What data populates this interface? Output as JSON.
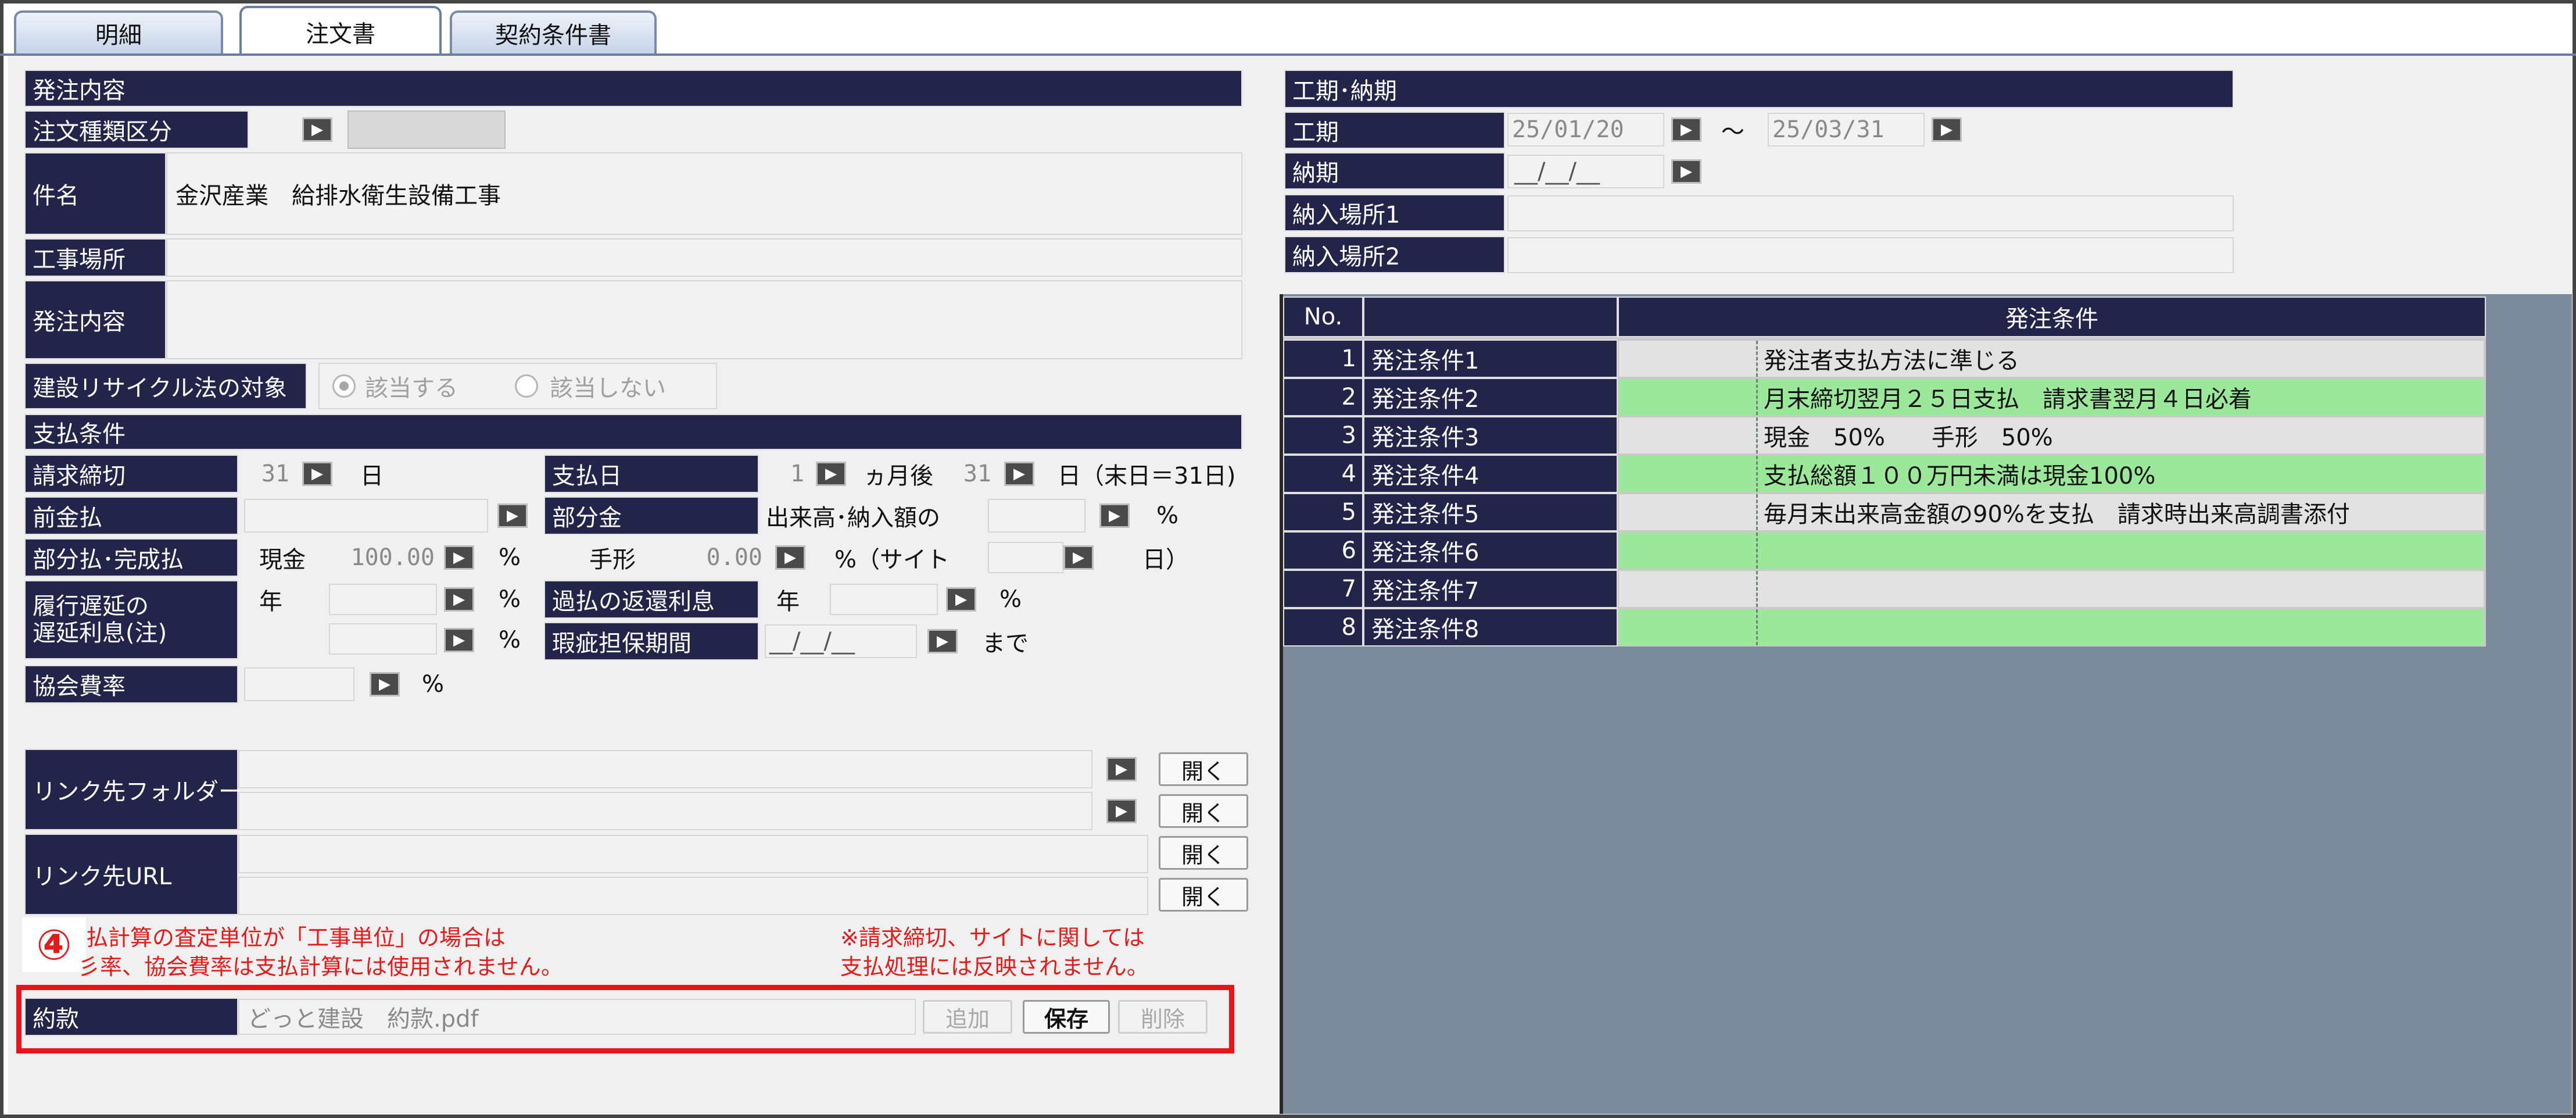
{
  "tabs": [
    {
      "label": "明細",
      "active": false
    },
    {
      "label": "注文書",
      "active": true
    },
    {
      "label": "契約条件書",
      "active": false
    }
  ],
  "order": {
    "section_title": "発注内容",
    "type_label": "注文種類区分",
    "type_value": "",
    "subject_label": "件名",
    "subject_value": "金沢産業　給排水衛生設備工事",
    "site_label": "工事場所",
    "site_value": "",
    "content_label": "発注内容",
    "content_value": "",
    "recycle_label": "建設リサイクル法の対象",
    "recycle_options": [
      "該当する",
      "該当しない"
    ],
    "recycle_selected": "該当する"
  },
  "payment": {
    "section_title": "支払条件",
    "closing_label": "請求締切",
    "closing_value": "31",
    "closing_unit": "日",
    "payday_label": "支払日",
    "payday_months": "1",
    "payday_months_unit": "ヵ月後",
    "payday_day": "31",
    "payday_day_unit": "日（末日＝31日)",
    "advance_label": "前金払",
    "partial_label": "部分金",
    "partial_value": "出来高･納入額の",
    "partial_percent_unit": "%",
    "split_label": "部分払･完成払",
    "cash_label": "現金",
    "cash_value": "100.00",
    "cash_unit": "%",
    "bill_label": "手形",
    "bill_value": "0.00",
    "bill_site_text": "%（サイト",
    "bill_site_unit": "日）",
    "delay_label_1": "履行遅延の",
    "delay_label_2": "遅延利息(注)",
    "delay_year": "年",
    "delay_unit_1": "%",
    "delay_unit_2": "%",
    "refund_label": "過払の返還利息",
    "refund_year": "年",
    "refund_unit": "%",
    "warranty_label": "瑕疵担保期間",
    "warranty_value": "__/__/__",
    "warranty_suffix": "まで",
    "assoc_label": "協会費率",
    "assoc_unit": "%"
  },
  "links": {
    "folder_label": "リンク先フォルダー",
    "url_label": "リンク先URL",
    "open_label": "開く"
  },
  "notes": {
    "step_number": "④",
    "left_line1": "払計算の査定単位が「工事単位」の場合は",
    "left_line2": "彡率、協会費率は支払計算には使用されません。",
    "right_line1": "※請求締切、サイトに関しては",
    "right_line2": "支払処理には反映されません。"
  },
  "terms": {
    "label": "約款",
    "file": "どっと建設　約款.pdf",
    "add_label": "追加",
    "save_label": "保存",
    "delete_label": "削除"
  },
  "schedule": {
    "section_title": "工期･納期",
    "period_label": "工期",
    "period_start": "25/01/20",
    "period_sep": "～",
    "period_end": "25/03/31",
    "delivery_label": "納期",
    "delivery_value": "__/__/__",
    "place1_label": "納入場所1",
    "place2_label": "納入場所2"
  },
  "conditions": {
    "col_no": "No.",
    "col_title": "発注条件",
    "rows": [
      {
        "no": "1",
        "name": "発注条件1",
        "text": "発注者支払方法に準じる",
        "color": "gray"
      },
      {
        "no": "2",
        "name": "発注条件2",
        "text": "月末締切翌月２５日支払　請求書翌月４日必着",
        "color": "green"
      },
      {
        "no": "3",
        "name": "発注条件3",
        "text": "現金　50%　　手形　50%",
        "color": "gray"
      },
      {
        "no": "4",
        "name": "発注条件4",
        "text": "支払総額１００万円未満は現金100%",
        "color": "green"
      },
      {
        "no": "5",
        "name": "発注条件5",
        "text": "毎月末出来高金額の90%を支払　請求時出来高調書添付",
        "color": "gray"
      },
      {
        "no": "6",
        "name": "発注条件6",
        "text": "",
        "color": "green"
      },
      {
        "no": "7",
        "name": "発注条件7",
        "text": "",
        "color": "gray"
      },
      {
        "no": "8",
        "name": "発注条件8",
        "text": "",
        "color": "green"
      }
    ]
  },
  "colors": {
    "header_bg": "#23244a",
    "row_green": "#9ce89a",
    "row_gray": "#e2e2e2",
    "highlight_red": "#e8141a"
  }
}
